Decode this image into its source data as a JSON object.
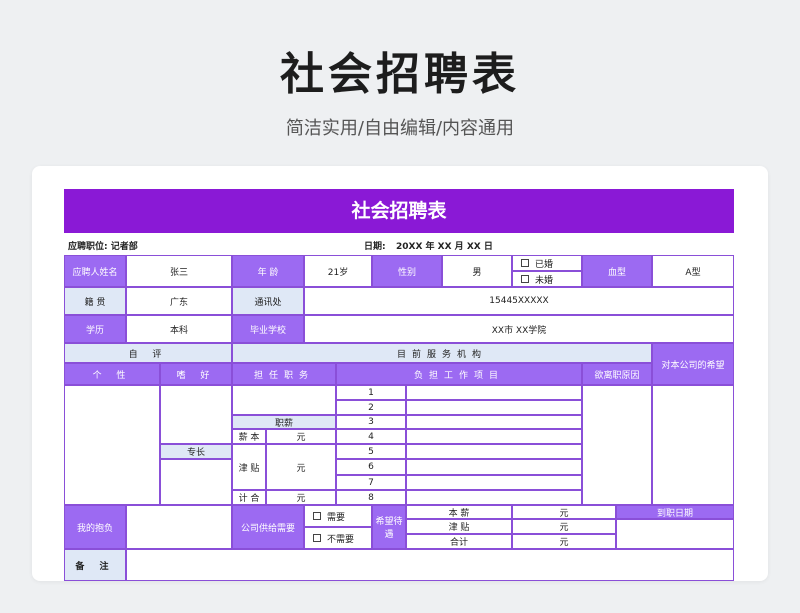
{
  "hero": {
    "title": "社会招聘表",
    "subtitle": "简洁实用/自由编辑/内容通用"
  },
  "form": {
    "title": "社会招聘表",
    "position_label": "应聘职位: 记者部",
    "date_label": "日期:",
    "date_value": "20XX 年 XX 月 XX 日",
    "name_label": "应聘人姓名",
    "name_value": "张三",
    "age_label": "年 龄",
    "age_value": "21岁",
    "gender_label": "性别",
    "gender_value": "男",
    "married": "已婚",
    "unmarried": "未婚",
    "blood_label": "血型",
    "blood_value": "A型",
    "origin_label": "籍 贯",
    "origin_value": "广东",
    "contact_label": "通讯处",
    "contact_value": "15445XXXXX",
    "edu_label": "学历",
    "edu_value": "本科",
    "school_label": "毕业学校",
    "school_value": "XX市 XX学院",
    "self_eval": "自 评",
    "current_org": "目前服务机构",
    "expectation": "对本公司的希望",
    "personality": "个 性",
    "hobby": "嗜 好",
    "duty": "担任职务",
    "work_items": "负担工作项目",
    "resign_reason": "欲离职原因",
    "salary_head": "职薪",
    "base_pay": "薪 本",
    "allowance": "津 贴",
    "total": "计 合",
    "unit": "元",
    "specialty": "专长",
    "row_numbers": [
      "1",
      "2",
      "3",
      "4",
      "5",
      "6",
      "7",
      "8"
    ],
    "ambition": "我的抱负",
    "company_provide": "公司供给需要",
    "need": "需要",
    "no_need": "不需要",
    "hope_treatment": "希望待遇",
    "hope_base": "本 薪",
    "hope_allowance": "津 贴",
    "hope_total": "合计",
    "start_date": "到职日期",
    "remark": "备 注"
  }
}
